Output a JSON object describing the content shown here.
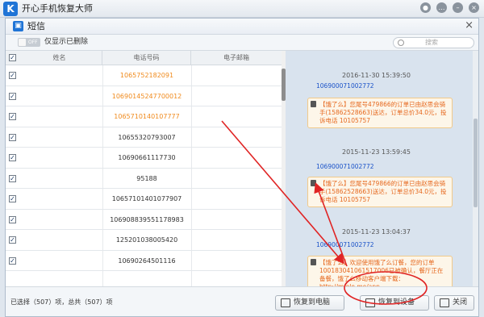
{
  "app": {
    "title": "开心手机恢复大师",
    "logo_letter": "K"
  },
  "titlebar_icons": [
    "wechat-icon",
    "chat-icon",
    "minimize-icon",
    "close-icon"
  ],
  "panel": {
    "title": "短信",
    "close": "×"
  },
  "filter": {
    "toggle_label": "OFF",
    "label": "仅显示已删除"
  },
  "search": {
    "placeholder": "搜索"
  },
  "table": {
    "headers": [
      "姓名",
      "电话号码",
      "电子邮箱"
    ],
    "rows": [
      {
        "number": "1065752182091",
        "highlight": true
      },
      {
        "number": "10690145247700012",
        "highlight": true
      },
      {
        "number": "1065710140107777",
        "highlight": true
      },
      {
        "number": "10655320793007",
        "highlight": false
      },
      {
        "number": "10690661117730",
        "highlight": false
      },
      {
        "number": "95188",
        "highlight": false
      },
      {
        "number": "10657101401077907",
        "highlight": false
      },
      {
        "number": "106908839551178983",
        "highlight": false
      },
      {
        "number": "125201038005420",
        "highlight": false
      },
      {
        "number": "10690264501116",
        "highlight": false
      }
    ]
  },
  "messages": [
    {
      "timestamp": "2016-11-30 15:39:50",
      "from": "106900071002772",
      "text": "【饿了么】您尾号479866的订单已由赵思会骑手(15862528663)送达，订单总价34.0元，投诉电话 10105757"
    },
    {
      "timestamp": "2015-11-23 13:59:45",
      "from": "106900071002772",
      "text": "【饿了么】您尾号479866的订单已由赵思会骑手(15862528663)送达，订单总价34.0元，投诉电话 10105757"
    },
    {
      "timestamp": "2015-11-23 13:04:37",
      "from": "106900071002772",
      "text": "【饿了么】欢迎使用饿了么订餐，您的订单100183041061517006已被确认，餐厅正在备餐，饿了么移动客户端下载：http://m.ele.me/app"
    }
  ],
  "footer": {
    "status": "已选择（507）项，总共（507）项",
    "restore_pc": "恢复到电脑",
    "restore_device": "恢复到设备",
    "close": "关闭"
  },
  "colors": {
    "accent": "#1f74d6",
    "highlight_number": "#f08a1c",
    "annotation": "#e02424"
  }
}
